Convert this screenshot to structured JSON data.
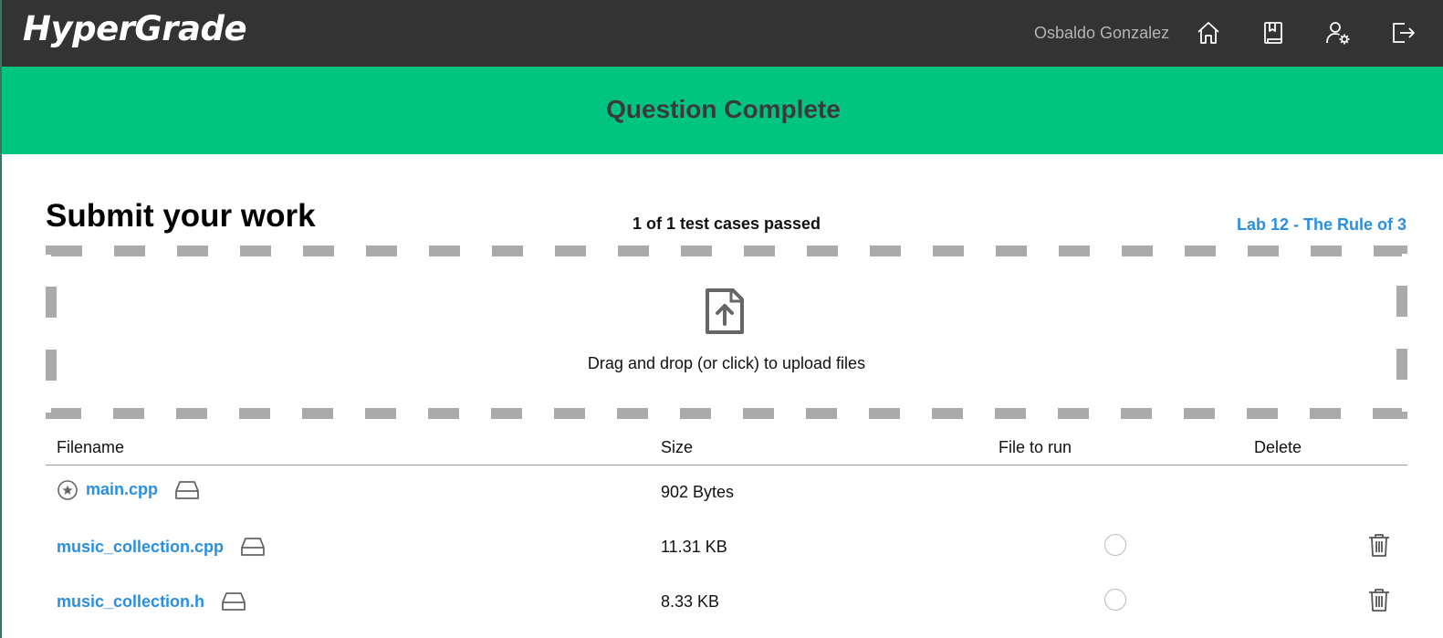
{
  "app": {
    "logo": "HyperGrade"
  },
  "topbar": {
    "username": "Osbaldo Gonzalez",
    "icons": [
      "home-icon",
      "book-icon",
      "user-settings-icon",
      "logout-icon"
    ]
  },
  "banner": {
    "title": "Question Complete",
    "color": "#00c47f"
  },
  "submit": {
    "heading": "Submit your work",
    "tests_status": "1 of 1 test cases passed",
    "lab_link": "Lab 12 - The Rule of 3"
  },
  "dropzone": {
    "text": "Drag and drop (or click) to upload files"
  },
  "files_table": {
    "headers": {
      "filename": "Filename",
      "size": "Size",
      "run": "File to run",
      "delete": "Delete"
    },
    "rows": [
      {
        "name": "main.cpp",
        "size": "902 Bytes",
        "is_main": true
      },
      {
        "name": "music_collection.cpp",
        "size": "11.31 KB",
        "is_main": false
      },
      {
        "name": "music_collection.h",
        "size": "8.33 KB",
        "is_main": false
      }
    ]
  },
  "colors": {
    "link": "#2a8fe0",
    "topbar": "#333333"
  }
}
